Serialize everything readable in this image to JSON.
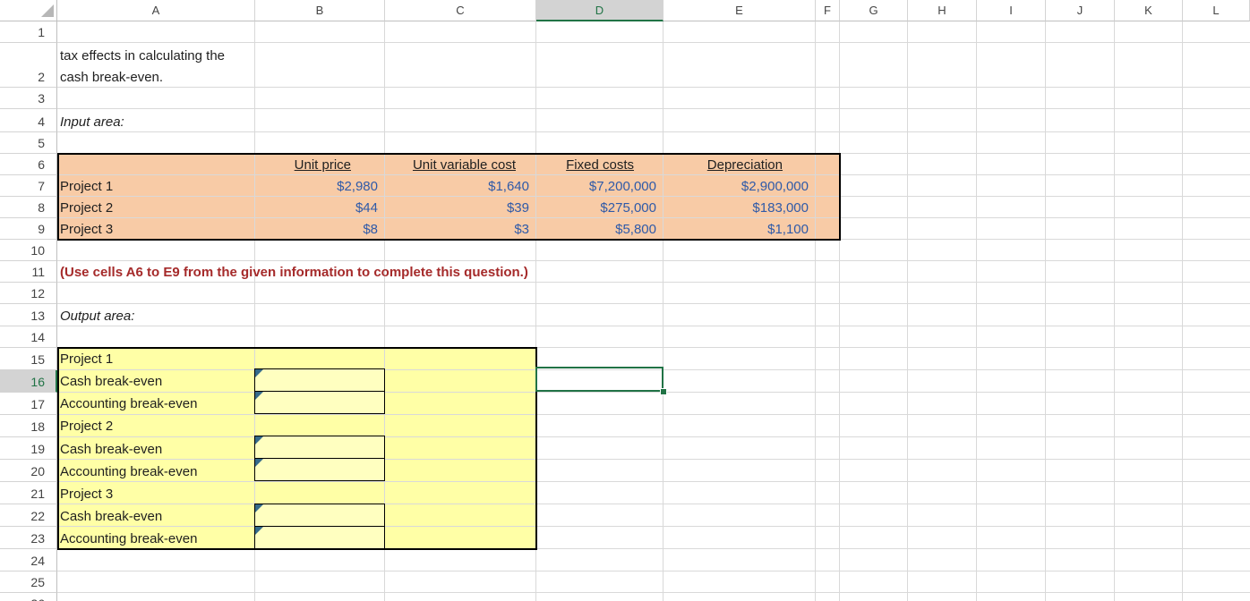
{
  "columns": [
    "A",
    "B",
    "C",
    "D",
    "E",
    "F",
    "G",
    "H",
    "I",
    "J",
    "K",
    "L"
  ],
  "rows": [
    "1",
    "2",
    "3",
    "4",
    "5",
    "6",
    "7",
    "8",
    "9",
    "10",
    "11",
    "12",
    "13",
    "14",
    "15",
    "16",
    "17",
    "18",
    "19",
    "20",
    "21",
    "22",
    "23",
    "24",
    "25",
    "26"
  ],
  "selected_cell": "D16",
  "intro_text_line1": "tax effects in calculating the",
  "intro_text_line2": "cash break-even.",
  "input_label": "Input area:",
  "output_label": "Output area:",
  "input_headers": {
    "unit_price": "Unit price",
    "unit_variable_cost": "Unit variable cost",
    "fixed_costs": "Fixed costs",
    "depreciation": "Depreciation"
  },
  "projects": [
    {
      "name": "Project 1",
      "unit_price": "$2,980",
      "unit_variable_cost": "$1,640",
      "fixed_costs": "$7,200,000",
      "depreciation": "$2,900,000"
    },
    {
      "name": "Project 2",
      "unit_price": "$44",
      "unit_variable_cost": "$39",
      "fixed_costs": "$275,000",
      "depreciation": "$183,000"
    },
    {
      "name": "Project 3",
      "unit_price": "$8",
      "unit_variable_cost": "$3",
      "fixed_costs": "$5,800",
      "depreciation": "$1,100"
    }
  ],
  "instruction": "(Use cells A6 to E9 from the given information to complete this question.)",
  "output_rows": [
    {
      "label": "Project 1"
    },
    {
      "label": "Cash break-even"
    },
    {
      "label": "Accounting break-even"
    },
    {
      "label": "Project 2"
    },
    {
      "label": "Cash break-even"
    },
    {
      "label": "Accounting break-even"
    },
    {
      "label": "Project 3"
    },
    {
      "label": "Cash break-even"
    },
    {
      "label": "Accounting break-even"
    }
  ],
  "colors": {
    "input_fill": "#f8cba6",
    "output_fill": "#ffffa6",
    "instruction_text": "#a52a2a",
    "value_text": "#2f5aa8",
    "selection": "#217346"
  }
}
